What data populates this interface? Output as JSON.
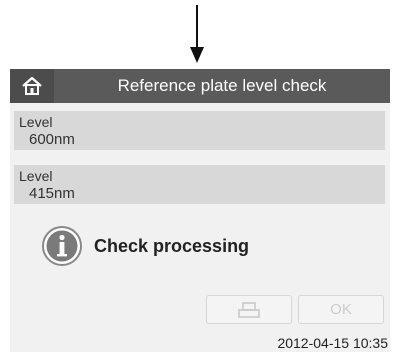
{
  "header": {
    "title": "Reference plate level check"
  },
  "levels": [
    {
      "label": "Level",
      "value": "600nm"
    },
    {
      "label": "Level",
      "value": "415nm"
    }
  ],
  "status": {
    "message": "Check processing",
    "icon": "info-icon"
  },
  "buttons": {
    "print_icon": "printer-icon",
    "ok_label": "OK"
  },
  "footer": {
    "datetime": "2012-04-15 10:35"
  },
  "colors": {
    "titlebar": "#5a5a5a",
    "panel": "#d8d8d8",
    "background": "#f1f1f1",
    "info_icon": "#777777"
  }
}
